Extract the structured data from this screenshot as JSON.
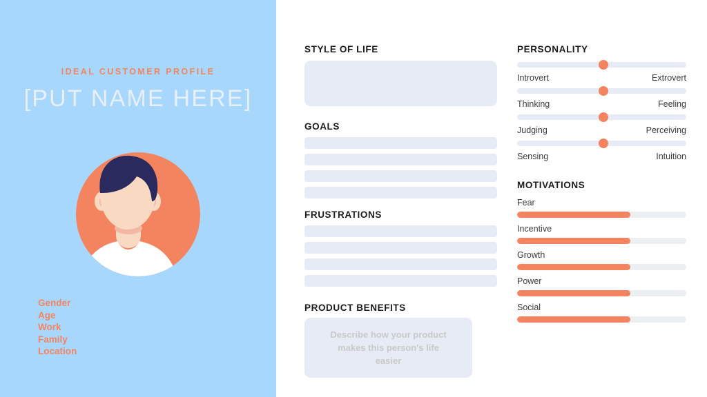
{
  "sidebar": {
    "kicker": "IDEAL CUSTOMER PROFILE",
    "name_placeholder": "[PUT NAME HERE]",
    "avatar": {
      "circle_color": "#f4845f",
      "hair_color": "#2b2a5e",
      "skin_color": "#fad9c2",
      "shirt_color": "#ffffff"
    },
    "fields": [
      {
        "label": "Gender"
      },
      {
        "label": "Age"
      },
      {
        "label": "Work"
      },
      {
        "label": "Family"
      },
      {
        "label": "Location"
      }
    ],
    "background_color": "#a8d7fd",
    "accent_color": "#f4845f"
  },
  "middle": {
    "style_of_life": {
      "title": "STYLE OF LIFE",
      "value": "",
      "placeholder": ""
    },
    "goals": {
      "title": "GOALS",
      "items": [
        "",
        "",
        "",
        ""
      ]
    },
    "frustrations": {
      "title": "FRUSTRATIONS",
      "items": [
        "",
        "",
        "",
        ""
      ]
    },
    "product_benefits": {
      "title": "PRODUCT BENEFITS",
      "placeholder": "Describe how your product makes this person's life easier",
      "value": ""
    }
  },
  "right": {
    "personality": {
      "title": "PERSONALITY",
      "sliders": [
        {
          "left_label": "Introvert",
          "right_label": "Extrovert",
          "value": 51
        },
        {
          "left_label": "Thinking",
          "right_label": "Feeling",
          "value": 51
        },
        {
          "left_label": "Judging",
          "right_label": "Perceiving",
          "value": 51
        },
        {
          "left_label": "Sensing",
          "right_label": "Intuition",
          "value": 51
        }
      ]
    },
    "motivations": {
      "title": "MOTIVATIONS",
      "bars": [
        {
          "label": "Fear",
          "value": 67
        },
        {
          "label": "Incentive",
          "value": 67
        },
        {
          "label": "Growth",
          "value": 67
        },
        {
          "label": "Power",
          "value": 67
        },
        {
          "label": "Social",
          "value": 67
        }
      ]
    },
    "fill_color": "#f4845f",
    "track_color": "#eceff2"
  }
}
